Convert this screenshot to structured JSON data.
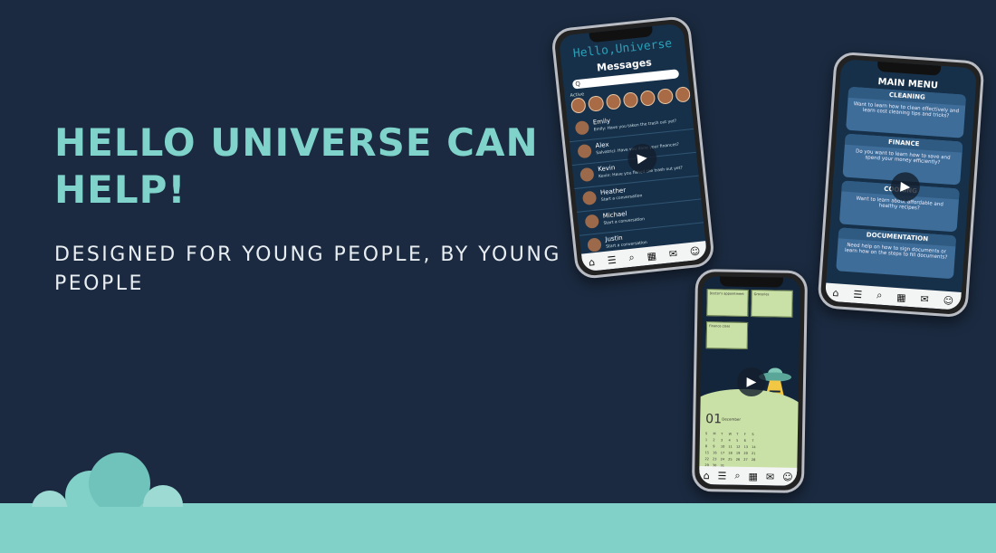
{
  "hero": {
    "title": "HELLO UNIVERSE CAN HELP!",
    "subtitle": "DESIGNED FOR YOUNG PEOPLE, BY YOUNG PEOPLE"
  },
  "colors": {
    "background": "#1b2a40",
    "accent": "#7fd3ca",
    "ground": "#82d1c8",
    "screen": "#163049"
  },
  "messages_phone": {
    "app_name": "Hello,Universe",
    "title": "Messages",
    "search_placeholder": "Q",
    "active_label": "Active",
    "contacts": [
      {
        "name": "Emily",
        "preview": "Emily: Have you taken the trash out yet?"
      },
      {
        "name": "Alex",
        "preview": "Salvatrici: Have you done your finances?"
      },
      {
        "name": "Kevin",
        "preview": "Kevin: Have you fished the trash out yet?"
      },
      {
        "name": "Heather",
        "preview": "Start a conversation"
      },
      {
        "name": "Michael",
        "preview": "Start a conversation"
      },
      {
        "name": "Justin",
        "preview": "Start a conversation"
      }
    ]
  },
  "menu_phone": {
    "title": "MAIN MENU",
    "cards": [
      {
        "name": "CLEANING",
        "desc": "Want to learn how to clean effectively and learn cost cleaning tips and tricks?"
      },
      {
        "name": "FINANCE",
        "desc": "Do you want to learn how to save and spend your money efficiently?"
      },
      {
        "name": "COOKING",
        "desc": "Want to learn about affordable and healthy recipes?"
      },
      {
        "name": "DOCUMENTATION",
        "desc": "Need help on how to sign documents or learn how on the steps to fill documents?"
      }
    ]
  },
  "planner_phone": {
    "notes": [
      "Doctor's appointment",
      "Groceries",
      "Finance class"
    ],
    "date_number": "01",
    "month": "December",
    "weekdays": [
      "S",
      "M",
      "T",
      "W",
      "T",
      "F",
      "S"
    ],
    "days": [
      "1",
      "2",
      "3",
      "4",
      "5",
      "6",
      "7",
      "8",
      "9",
      "10",
      "11",
      "12",
      "13",
      "14",
      "15",
      "16",
      "17",
      "18",
      "19",
      "20",
      "21",
      "22",
      "23",
      "24",
      "25",
      "26",
      "27",
      "28",
      "29",
      "30",
      "31"
    ]
  },
  "nav_icons": [
    "home-icon",
    "menu-icon",
    "search-icon",
    "calendar-icon",
    "chat-icon",
    "profile-icon"
  ]
}
